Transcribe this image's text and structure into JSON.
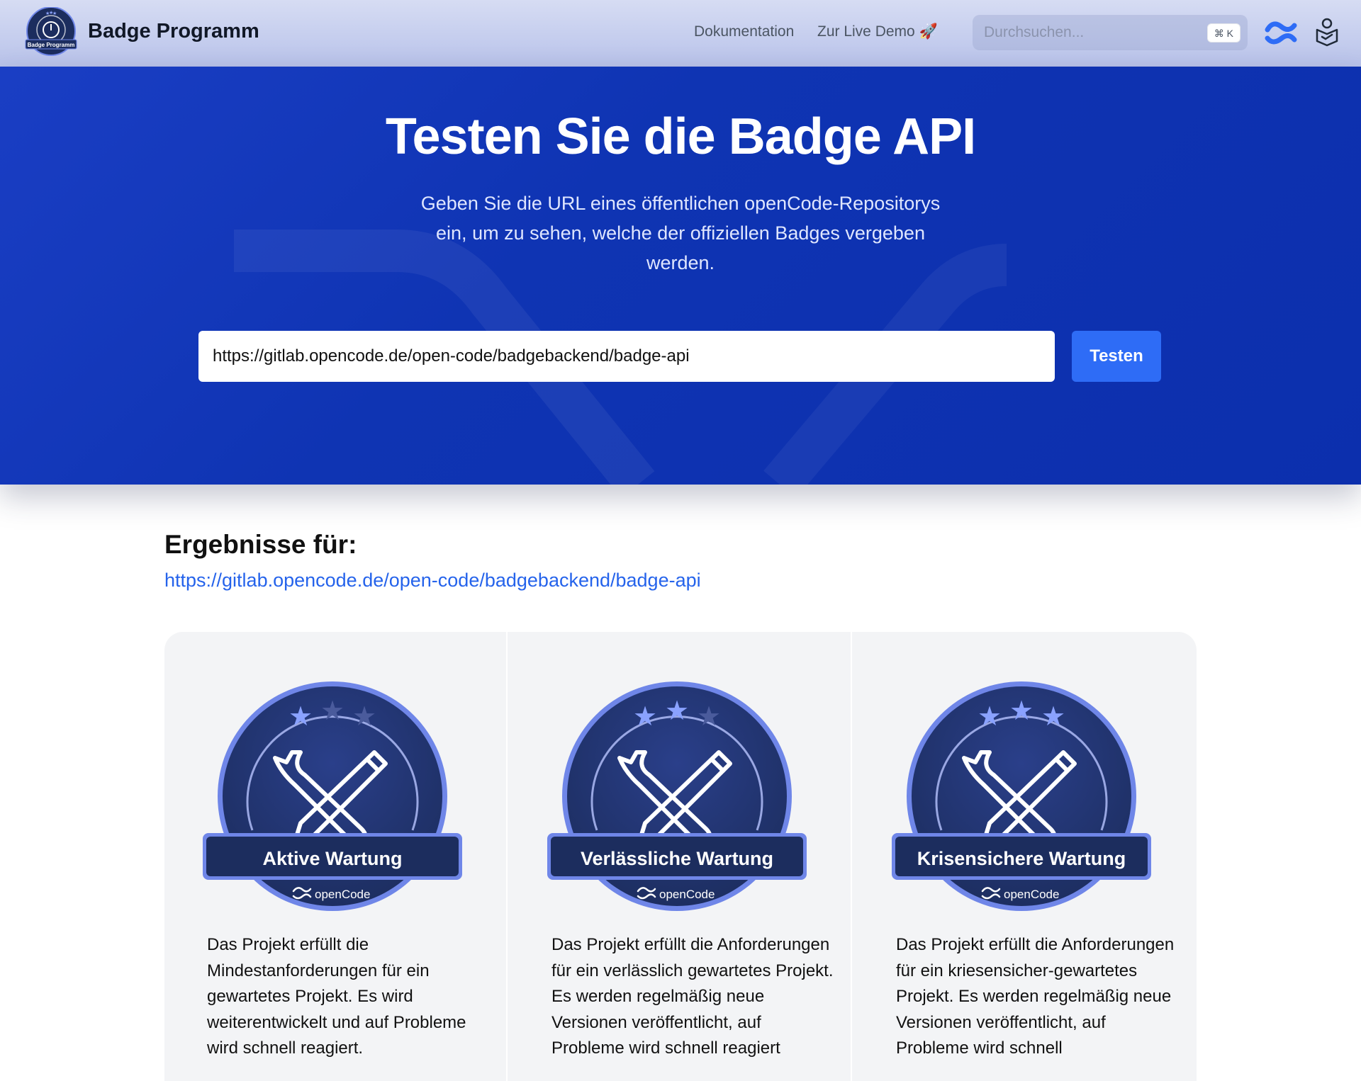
{
  "header": {
    "brand": "Badge Programm",
    "logo_text": "Badge Programm",
    "nav": [
      {
        "label": "Dokumentation"
      },
      {
        "label": "Zur Live Demo 🚀"
      }
    ],
    "search": {
      "placeholder": "Durchsuchen...",
      "shortcut": "⌘ K"
    },
    "icons": [
      "opencode-icon",
      "book-icon"
    ]
  },
  "hero": {
    "title": "Testen Sie die Badge API",
    "subtitle": "Geben Sie die URL eines öffentlichen openCode-Repositorys ein, um zu sehen, welche der offiziellen Badges vergeben werden.",
    "input_value": "https://gitlab.opencode.de/open-code/badgebackend/badge-api",
    "button_label": "Testen"
  },
  "results": {
    "heading": "Ergebnisse für:",
    "url": "https://gitlab.opencode.de/open-code/badgebackend/badge-api",
    "badges": [
      {
        "title": "Aktive Wartung",
        "brand": "openCode",
        "stars_filled": 1,
        "description": "Das Projekt erfüllt die Mindestanforderungen für ein gewartetes Projekt. Es wird weiterentwickelt und auf Probleme wird schnell reagiert."
      },
      {
        "title": "Verlässliche Wartung",
        "brand": "openCode",
        "stars_filled": 2,
        "description": "Das Projekt erfüllt die Anforderungen für ein verlässlich gewartetes Projekt. Es werden regelmäßig neue Versionen veröffentlicht, auf Probleme wird schnell reagiert"
      },
      {
        "title": "Krisensichere Wartung",
        "brand": "openCode",
        "stars_filled": 3,
        "description": "Das Projekt erfüllt die Anforderungen für ein kriesensicher-gewartetes Projekt. Es werden regelmäßig neue Versionen veröffentlicht, auf Probleme wird schnell"
      }
    ]
  },
  "colors": {
    "hero_bg": "#1036b8",
    "accent": "#2e6cf6",
    "link": "#2563eb",
    "badge_dark": "#1c2d5e",
    "badge_rim": "#6f86e8",
    "star_on": "#8aa2ff",
    "star_off": "#4a5b9c"
  }
}
